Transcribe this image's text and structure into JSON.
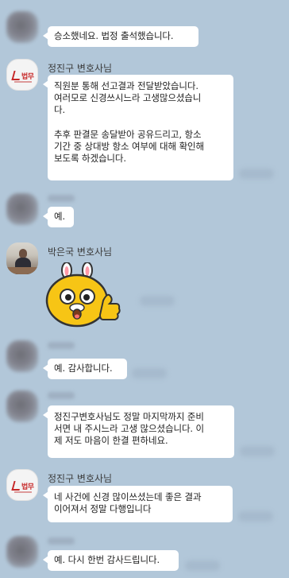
{
  "messages": [
    {
      "text": "승소했네요. 법정 출석했습니다."
    },
    {
      "sender": "정진구 변호사님",
      "text": "직원분 통해 선고결과 전달받았습니다.\n여러모로 신경쓰시느라 고생많으셨습니\n다.\n\n추후 판결문 송달받아 공유드리고, 항소\n기간 중 상대방 항소 여부에 대해 확인해\n보도록 하겠습니다."
    },
    {
      "text": "예."
    },
    {
      "sender": "박은국 변호사님",
      "sticker": "rabbit-hat-thumbs-up-emoticon"
    },
    {
      "text": "예. 감사합니다."
    },
    {
      "text": "정진구변호사님도 정말 마지막까지 준비\n서면 내 주시느라 고생 많으셨습니다. 이\n제 저도 마음이 한결 편하네요."
    },
    {
      "sender": "정진구 변호사님",
      "text": "네 사건에 신경 많이쓰셨는데 좋은 결과\n이어져서 정말 다행입니다"
    },
    {
      "text": "예. 다시 한번 감사드립니다."
    }
  ],
  "firm_logo_text": "법무",
  "colors": {
    "background": "#b2c7d9",
    "bubble": "#ffffff",
    "sticker_yellow": "#f7c515"
  }
}
